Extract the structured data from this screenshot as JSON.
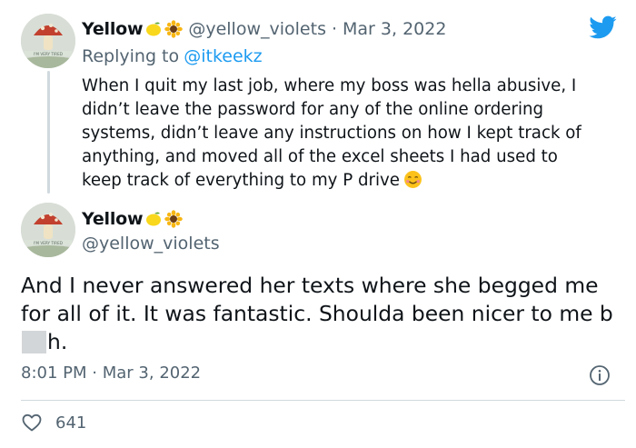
{
  "colors": {
    "twitter_blue": "#1d9bf0",
    "muted_text": "#536471",
    "primary_text": "#0f1419",
    "divider": "#cfd9de"
  },
  "icons": {
    "brand": "twitter-bird-icon",
    "name_emojis": [
      "lemon-emoji-icon",
      "sunflower-emoji-icon"
    ],
    "tweet_emoji": "smiling-face-with-hearts-emoji-icon",
    "info": "info-icon",
    "like": "heart-outline-icon"
  },
  "reply_tweet": {
    "display_name": "Yellow",
    "handle": "@yellow_violets",
    "separator": "·",
    "date": "Mar 3, 2022",
    "replying_to_prefix": "Replying to",
    "replying_to_handle": "@itkeekz",
    "text": "When I quit my last job, where my boss was hella abusive, I\ndidn’t leave the password for any of the online ordering\nsystems, didn’t leave any instructions on how I kept track of\nanything, and moved all of the excel sheets I had used to\nkeep track of everything to my P drive"
  },
  "main_tweet": {
    "display_name": "Yellow",
    "handle": "@yellow_violets",
    "text_before": "And I never answered her texts where she begged me for all of it. It was fantastic. Shoulda been nicer to me b",
    "text_after": "h.",
    "time": "8:01 PM",
    "separator": "·",
    "date": "Mar 3, 2022",
    "like_count": "641"
  }
}
